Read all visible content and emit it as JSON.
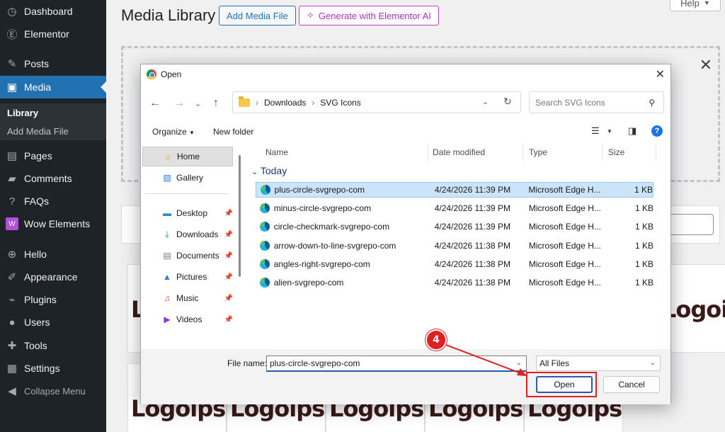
{
  "wp_sidebar": {
    "items": [
      {
        "label": "Dashboard",
        "icon": "dashboard-icon"
      },
      {
        "label": "Elementor",
        "icon": "elementor-icon"
      },
      {
        "label": "Posts",
        "icon": "pushpin-icon"
      },
      {
        "label": "Media",
        "icon": "media-icon"
      },
      {
        "label": "Pages",
        "icon": "pages-icon"
      },
      {
        "label": "Comments",
        "icon": "comments-icon"
      },
      {
        "label": "FAQs",
        "icon": "faq-icon"
      },
      {
        "label": "Wow Elements",
        "icon": "wow-elements-icon"
      },
      {
        "label": "Hello",
        "icon": "hello-icon"
      },
      {
        "label": "Appearance",
        "icon": "appearance-icon"
      },
      {
        "label": "Plugins",
        "icon": "plugins-icon"
      },
      {
        "label": "Users",
        "icon": "users-icon"
      },
      {
        "label": "Tools",
        "icon": "tools-icon"
      },
      {
        "label": "Settings",
        "icon": "settings-icon"
      },
      {
        "label": "Collapse Menu",
        "icon": "collapse-icon"
      }
    ],
    "media_sub": [
      "Library",
      "Add Media File"
    ],
    "active_color": "#2271b1"
  },
  "wp_main": {
    "title": "Media Library",
    "add_button": "Add Media File",
    "ai_button": "Generate with Elementor AI",
    "help_button": "Help",
    "thumb_text": "Logoips"
  },
  "dialog": {
    "title": "Open",
    "address": [
      "Downloads",
      "SVG Icons"
    ],
    "search_placeholder": "Search SVG Icons",
    "organize": "Organize",
    "new_folder": "New folder",
    "nav": [
      {
        "label": "Home",
        "icon": "home-icon",
        "pinned": false
      },
      {
        "label": "Gallery",
        "icon": "gallery-icon",
        "pinned": false
      },
      {
        "label": "Desktop",
        "icon": "desktop-icon",
        "pinned": true
      },
      {
        "label": "Downloads",
        "icon": "download-icon",
        "pinned": true
      },
      {
        "label": "Documents",
        "icon": "documents-icon",
        "pinned": true
      },
      {
        "label": "Pictures",
        "icon": "pictures-icon",
        "pinned": true
      },
      {
        "label": "Music",
        "icon": "music-icon",
        "pinned": true
      },
      {
        "label": "Videos",
        "icon": "videos-icon",
        "pinned": true
      }
    ],
    "columns": [
      "Name",
      "Date modified",
      "Type",
      "Size"
    ],
    "group": "Today",
    "files": [
      {
        "name": "plus-circle-svgrepo-com",
        "date": "4/24/2026 11:39 PM",
        "type": "Microsoft Edge H...",
        "size": "1 KB",
        "selected": true
      },
      {
        "name": "minus-circle-svgrepo-com",
        "date": "4/24/2026 11:39 PM",
        "type": "Microsoft Edge H...",
        "size": "1 KB"
      },
      {
        "name": "circle-checkmark-svgrepo-com",
        "date": "4/24/2026 11:39 PM",
        "type": "Microsoft Edge H...",
        "size": "1 KB"
      },
      {
        "name": "arrow-down-to-line-svgrepo-com",
        "date": "4/24/2026 11:38 PM",
        "type": "Microsoft Edge H...",
        "size": "1 KB"
      },
      {
        "name": "angles-right-svgrepo-com",
        "date": "4/24/2026 11:38 PM",
        "type": "Microsoft Edge H...",
        "size": "1 KB"
      },
      {
        "name": "alien-svgrepo-com",
        "date": "4/24/2026 11:38 PM",
        "type": "Microsoft Edge H...",
        "size": "1 KB"
      }
    ],
    "file_name_label": "File name:",
    "file_name_value": "plus-circle-svgrepo-com",
    "file_type": "All Files",
    "open_button": "Open",
    "cancel_button": "Cancel"
  },
  "annotation": {
    "step_number": "4",
    "color": "#e02020"
  }
}
